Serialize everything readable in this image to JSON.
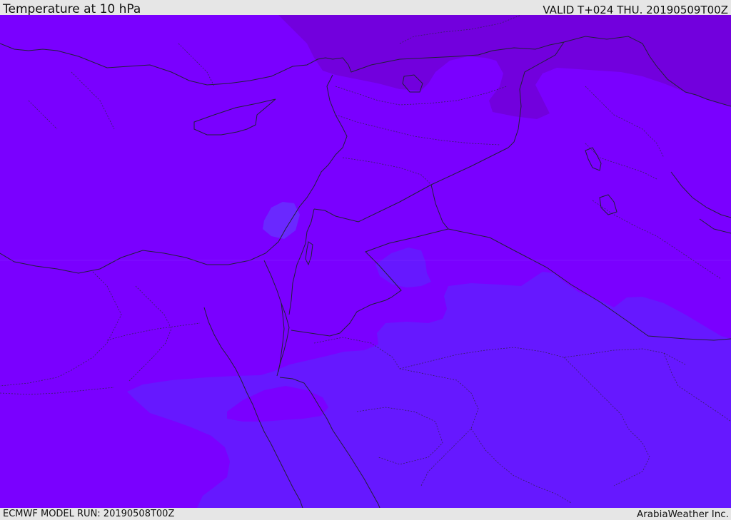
{
  "header": {
    "title": "Temperature at 10 hPa",
    "valid": "VALID T+024 THU. 20190509T00Z"
  },
  "footer": {
    "model_run": "ECMWF MODEL RUN: 20190508T00Z",
    "provider": "ArabiaWeather Inc."
  },
  "colors": {
    "field_main": "#7a00ff",
    "field_cool": "#6618ff",
    "field_warm": "#7200dd",
    "field_lake": "#6a28ff",
    "border": "#222244",
    "background": "#e6e6e6"
  }
}
